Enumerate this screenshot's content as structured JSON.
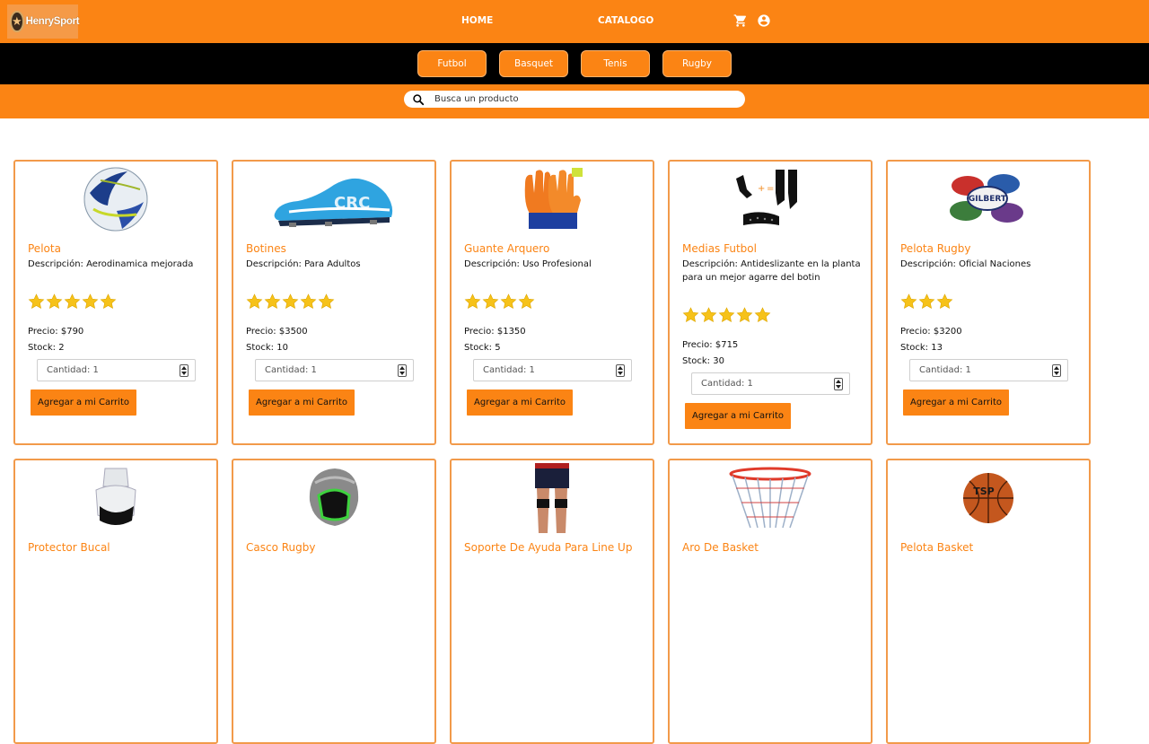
{
  "header": {
    "logo_text": "HenrySport",
    "nav": {
      "home": "HOME",
      "catalogo": "CATALOGO"
    },
    "icons": {
      "cart": "cart-icon",
      "user": "user-icon"
    }
  },
  "categories": [
    "Futbol",
    "Basquet",
    "Tenis",
    "Rugby"
  ],
  "search": {
    "placeholder": "Busca un producto"
  },
  "colors": {
    "primary": "#fb8414",
    "category_bar": "#000000",
    "star": "#f6c21a"
  },
  "labels": {
    "desc_prefix": "Descripción: ",
    "price_prefix": "Precio: ",
    "stock_prefix": "Stock: ",
    "qty_prefix": "Cantidad: ",
    "add_button": "Agregar a mi Carrito"
  },
  "products": [
    {
      "title": "Pelota",
      "description": "Descripción: Aerodinamica mejorada",
      "rating": 5,
      "price": "Precio: $790",
      "stock": "Stock: 2",
      "quantity": "Cantidad: 1",
      "button": "Agregar a mi Carrito"
    },
    {
      "title": "Botines",
      "description": "Descripción: Para Adultos",
      "rating": 5,
      "price": "Precio: $3500",
      "stock": "Stock: 10",
      "quantity": "Cantidad: 1",
      "button": "Agregar a mi Carrito"
    },
    {
      "title": "Guante Arquero",
      "description": "Descripción: Uso Profesional",
      "rating": 4,
      "price": "Precio: $1350",
      "stock": "Stock: 5",
      "quantity": "Cantidad: 1",
      "button": "Agregar a mi Carrito"
    },
    {
      "title": "Medias Futbol",
      "description": "Descripción: Antideslizante en la planta para un mejor agarre del botin",
      "rating": 5,
      "price": "Precio: $715",
      "stock": "Stock: 30",
      "quantity": "Cantidad: 1",
      "button": "Agregar a mi Carrito"
    },
    {
      "title": "Pelota Rugby",
      "description": "Descripción: Oficial Naciones",
      "rating": 3,
      "price": "Precio: $3200",
      "stock": "Stock: 13",
      "quantity": "Cantidad: 1",
      "button": "Agregar a mi Carrito"
    },
    {
      "title": "Protector Bucal"
    },
    {
      "title": "Casco Rugby"
    },
    {
      "title": "Soporte De Ayuda Para Line Up"
    },
    {
      "title": "Aro De Basket"
    },
    {
      "title": "Pelota Basket"
    }
  ],
  "image_brand_text": {
    "rugby_ball": "GILBERT",
    "basketball": "TSP"
  }
}
